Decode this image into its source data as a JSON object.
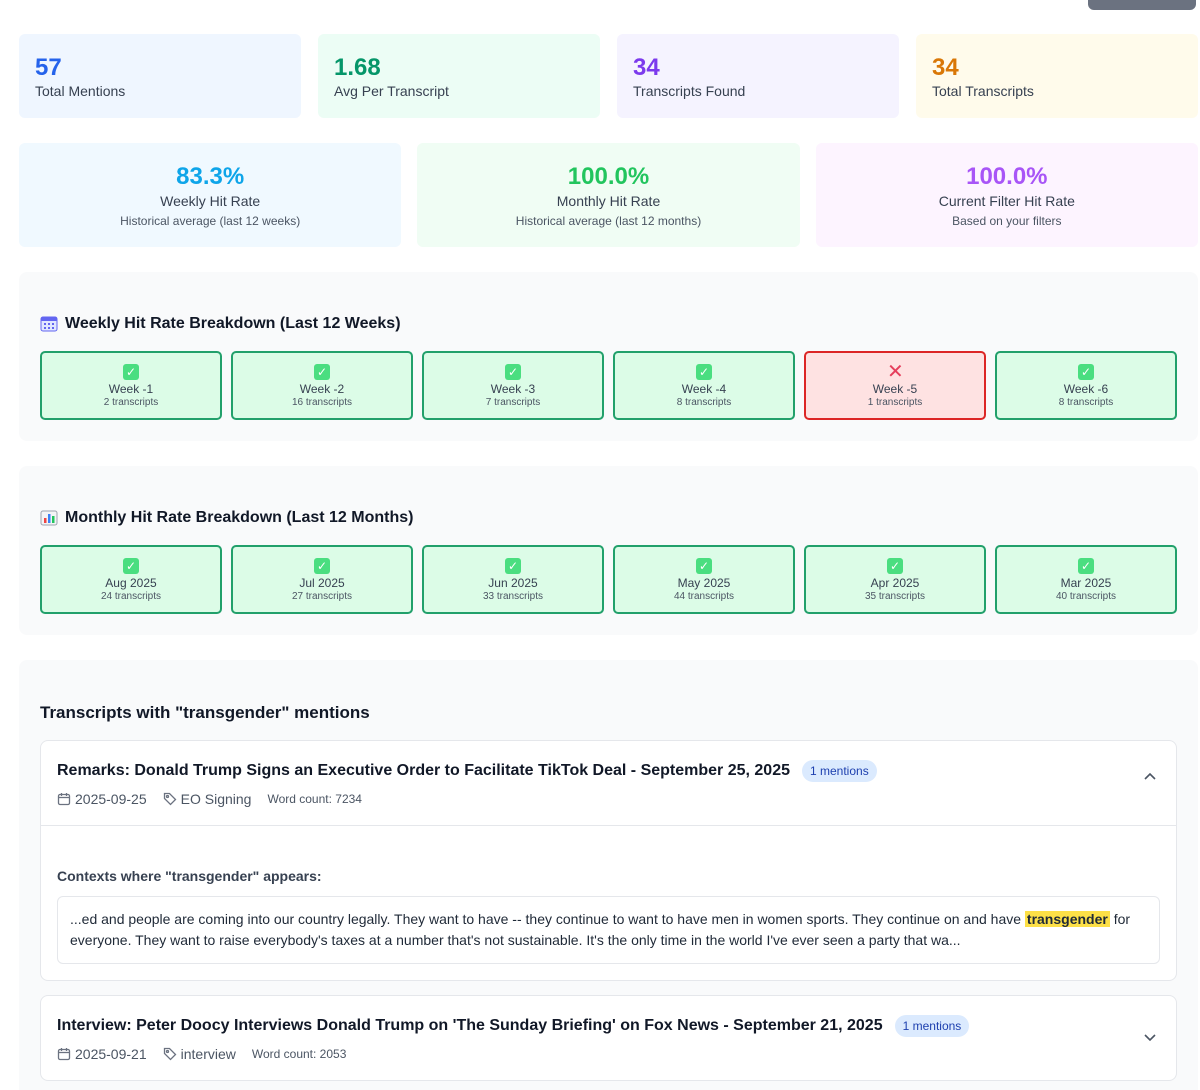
{
  "stats": [
    {
      "value": "57",
      "label": "Total Mentions",
      "color": "#2563eb",
      "bg": "#eff6ff"
    },
    {
      "value": "1.68",
      "label": "Avg Per Transcript",
      "color": "#059669",
      "bg": "#ecfdf5"
    },
    {
      "value": "34",
      "label": "Transcripts Found",
      "color": "#7c3aed",
      "bg": "#f5f3ff"
    },
    {
      "value": "34",
      "label": "Total Transcripts",
      "color": "#d97706",
      "bg": "#fffbeb"
    }
  ],
  "hit_rates": [
    {
      "value": "83.3%",
      "label": "Weekly Hit Rate",
      "sub": "Historical average (last 12 weeks)",
      "color": "#0ea5e9",
      "bg": "#f0f9ff"
    },
    {
      "value": "100.0%",
      "label": "Monthly Hit Rate",
      "sub": "Historical average (last 12 months)",
      "color": "#22c55e",
      "bg": "#f0fdf4"
    },
    {
      "value": "100.0%",
      "label": "Current Filter Hit Rate",
      "sub": "Based on your filters",
      "color": "#a855f7",
      "bg": "#fdf4ff"
    }
  ],
  "weekly": {
    "title": "Weekly Hit Rate Breakdown (Last 12 Weeks)",
    "icon": "calendar-icon",
    "items": [
      {
        "label": "Week -1",
        "sub": "2 transcripts",
        "hit": true
      },
      {
        "label": "Week -2",
        "sub": "16 transcripts",
        "hit": true
      },
      {
        "label": "Week -3",
        "sub": "7 transcripts",
        "hit": true
      },
      {
        "label": "Week -4",
        "sub": "8 transcripts",
        "hit": true
      },
      {
        "label": "Week -5",
        "sub": "1 transcripts",
        "hit": false
      },
      {
        "label": "Week -6",
        "sub": "8 transcripts",
        "hit": true
      }
    ]
  },
  "monthly": {
    "title": "Monthly Hit Rate Breakdown (Last 12 Months)",
    "icon": "bar-chart-icon",
    "items": [
      {
        "label": "Aug 2025",
        "sub": "24 transcripts",
        "hit": true
      },
      {
        "label": "Jul 2025",
        "sub": "27 transcripts",
        "hit": true
      },
      {
        "label": "Jun 2025",
        "sub": "33 transcripts",
        "hit": true
      },
      {
        "label": "May 2025",
        "sub": "44 transcripts",
        "hit": true
      },
      {
        "label": "Apr 2025",
        "sub": "35 transcripts",
        "hit": true
      },
      {
        "label": "Mar 2025",
        "sub": "40 transcripts",
        "hit": true
      }
    ]
  },
  "transcripts": {
    "title": "Transcripts with \"transgender\" mentions",
    "items": [
      {
        "title": "Remarks: Donald Trump Signs an Executive Order to Facilitate TikTok Deal - September 25, 2025",
        "badge": "1 mentions",
        "date": "2025-09-25",
        "tag": "EO Signing",
        "word_count": "Word count: 7234",
        "expanded": true,
        "contexts_title": "Contexts where \"transgender\" appears:",
        "context_before": "...ed and people are coming into our country legally. They want to have -- they continue to want to have men in women sports. They continue on and have ",
        "context_highlight": "transgender",
        "context_after": " for everyone. They want to raise everybody's taxes at a number that's not sustainable. It's the only time in the world I've ever seen a party that wa..."
      },
      {
        "title": "Interview: Peter Doocy Interviews Donald Trump on 'The Sunday Briefing' on Fox News - September 21, 2025",
        "badge": "1 mentions",
        "date": "2025-09-21",
        "tag": "interview",
        "word_count": "Word count: 2053",
        "expanded": false
      }
    ]
  }
}
